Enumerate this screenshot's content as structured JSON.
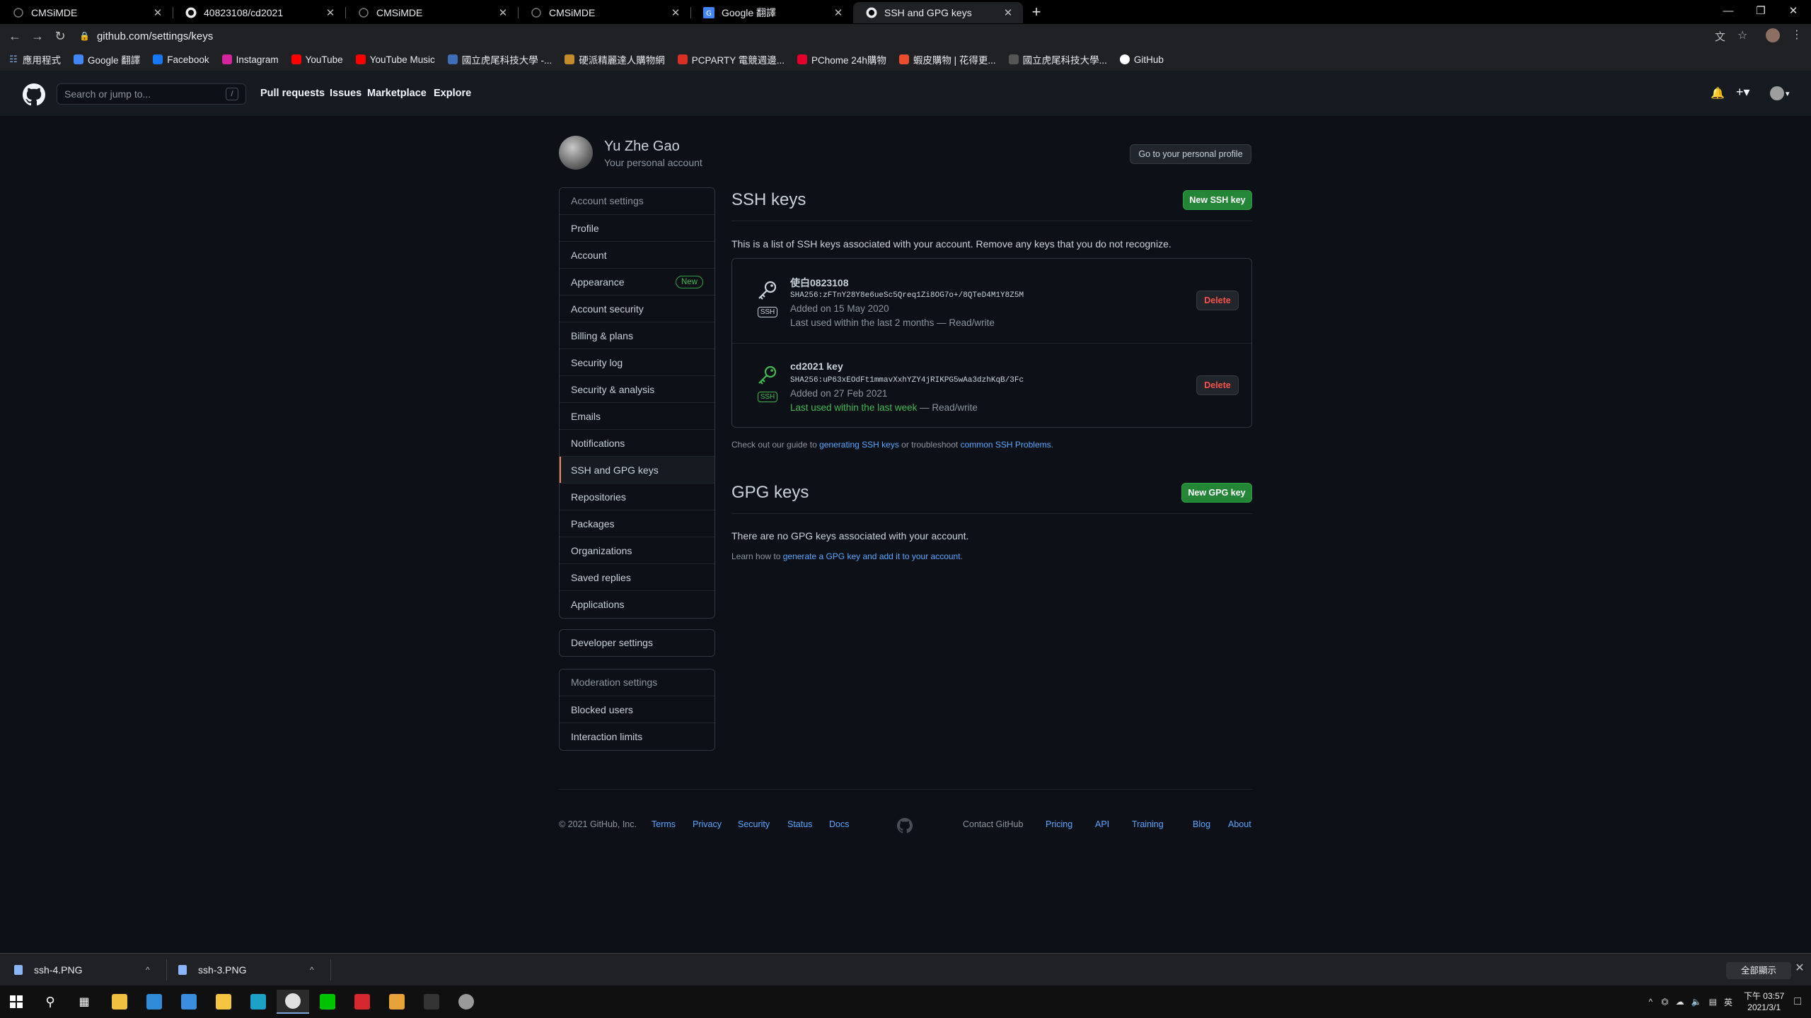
{
  "browser": {
    "tabs": [
      {
        "label": "CMSiMDE",
        "icon": "cmsimde-icon"
      },
      {
        "label": "40823108/cd2021",
        "icon": "github-icon"
      },
      {
        "label": "CMSiMDE",
        "icon": "cmsimde-icon"
      },
      {
        "label": "CMSiMDE",
        "icon": "cmsimde-icon"
      },
      {
        "label": "Google 翻譯",
        "icon": "translate-icon"
      },
      {
        "label": "SSH and GPG keys",
        "icon": "github-icon"
      }
    ],
    "url": "github.com/settings/keys",
    "bookmarks": [
      {
        "label": "應用程式",
        "color": "#8ab4f8"
      },
      {
        "label": "Google 翻譯",
        "color": "#4285f4"
      },
      {
        "label": "Facebook",
        "color": "#1877f2"
      },
      {
        "label": "Instagram",
        "color": "#d6249f"
      },
      {
        "label": "YouTube",
        "color": "#ff0000"
      },
      {
        "label": "YouTube Music",
        "color": "#ff0000"
      },
      {
        "label": "國立虎尾科技大學 -...",
        "color": "#3c6fb5"
      },
      {
        "label": "硬派精麗達人購物網",
        "color": "#c28b2c"
      },
      {
        "label": "PCPARTY 電競週邊...",
        "color": "#d93025"
      },
      {
        "label": "PChome 24h購物",
        "color": "#e4002b"
      },
      {
        "label": "蝦皮購物 | 花得更...",
        "color": "#ee4d2d"
      },
      {
        "label": "國立虎尾科技大學...",
        "color": "#555555"
      },
      {
        "label": "GitHub",
        "color": "#ffffff"
      }
    ]
  },
  "header": {
    "search_placeholder": "Search or jump to...",
    "search_key": "/",
    "nav": [
      "Pull requests",
      "Issues",
      "Marketplace",
      "Explore"
    ]
  },
  "profile": {
    "name": "Yu Zhe Gao",
    "subtitle": "Your personal account",
    "button": "Go to your personal profile"
  },
  "sidebar": {
    "account_header": "Account settings",
    "account_items": [
      "Profile",
      "Account",
      "Appearance",
      "Account security",
      "Billing & plans",
      "Security log",
      "Security & analysis",
      "Emails",
      "Notifications",
      "SSH and GPG keys",
      "Repositories",
      "Packages",
      "Organizations",
      "Saved replies",
      "Applications"
    ],
    "new_badge": "New",
    "developer": "Developer settings",
    "moderation_header": "Moderation settings",
    "moderation_items": [
      "Blocked users",
      "Interaction limits"
    ]
  },
  "ssh": {
    "title": "SSH keys",
    "new_button": "New SSH key",
    "intro": "This is a list of SSH keys associated with your account. Remove any keys that you do not recognize.",
    "icon_label": "SSH",
    "delete_label": "Delete",
    "keys": [
      {
        "name": "使白0823108",
        "fingerprint": "SHA256:zFTnY28Y8e6ueSc5Qreq1Zi8OG7o+/8QTeD4M1Y8Z5M",
        "added": "Added on 15 May 2020",
        "last_used": "Last used within the last 2 months",
        "access": "— Read/write",
        "recent": false
      },
      {
        "name": "cd2021 key",
        "fingerprint": "SHA256:uP63xEOdFt1mmavXxhYZY4jRIKPG5wAa3dzhKqB/3Fc",
        "added": "Added on 27 Feb 2021",
        "last_used": "Last used within the last week",
        "access": "— Read/write",
        "recent": true
      }
    ],
    "guide_prefix": "Check out our guide to",
    "guide_link1": "generating SSH keys",
    "guide_middle": "or troubleshoot",
    "guide_link2": "common SSH Problems",
    "guide_suffix": "."
  },
  "gpg": {
    "title": "GPG keys",
    "new_button": "New GPG key",
    "empty": "There are no GPG keys associated with your account.",
    "learn_prefix": "Learn how to",
    "learn_link": "generate a GPG key and add it to your account",
    "learn_suffix": "."
  },
  "footer": {
    "copyright": "© 2021 GitHub, Inc.",
    "left_links": [
      "Terms",
      "Privacy",
      "Security",
      "Status",
      "Docs"
    ],
    "contact": "Contact GitHub",
    "right_links": [
      "Pricing",
      "API",
      "Training",
      "Blog",
      "About"
    ]
  },
  "downloads": {
    "files": [
      "ssh-4.PNG",
      "ssh-3.PNG"
    ],
    "show_all": "全部顯示"
  },
  "taskbar": {
    "apps": [
      {
        "name": "file-manager",
        "color": "#f0c040"
      },
      {
        "name": "azure",
        "color": "#2d8bd8"
      },
      {
        "name": "mail",
        "color": "#3b8ede"
      },
      {
        "name": "explorer",
        "color": "#f4c542"
      },
      {
        "name": "edge",
        "color": "#1da1c7"
      },
      {
        "name": "chrome",
        "color": "#e0e0e0"
      },
      {
        "name": "line",
        "color": "#00c300"
      },
      {
        "name": "acrobat",
        "color": "#d7282f"
      },
      {
        "name": "illustrator-app",
        "color": "#e8a23a"
      },
      {
        "name": "terminal",
        "color": "#333333"
      },
      {
        "name": "app-round",
        "color": "#9a9a9a"
      }
    ],
    "ime": "英",
    "time": "下午 03:57",
    "date": "2021/3/1"
  }
}
